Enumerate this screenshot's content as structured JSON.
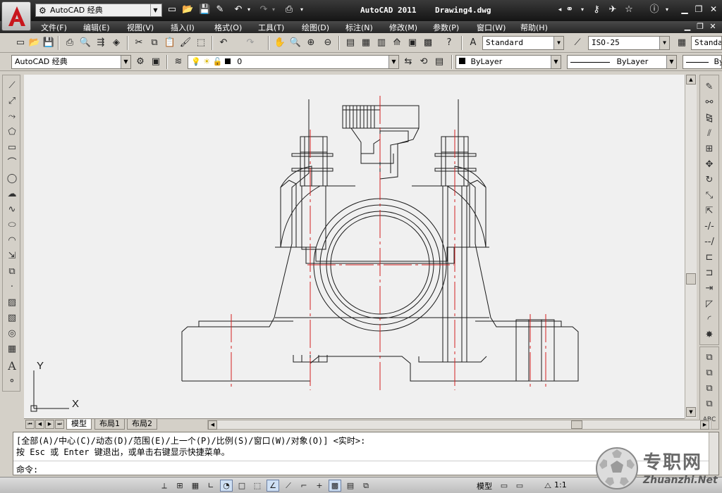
{
  "title_bar": {
    "workspace": "AutoCAD 经典",
    "app_name": "AutoCAD 2011",
    "document": "Drawing4.dwg",
    "quick_access_icons": [
      "new-icon",
      "open-icon",
      "save-icon",
      "save-as-icon",
      "undo-icon",
      "redo-icon",
      "plot-icon"
    ],
    "right_icons": [
      "binoculars-icon",
      "key-icon",
      "satellite-icon",
      "star-icon",
      "help-icon"
    ],
    "window_controls": [
      "minimize",
      "restore",
      "close"
    ]
  },
  "menu": {
    "items": [
      "文件(F)",
      "编辑(E)",
      "视图(V)",
      "插入(I)",
      "格式(O)",
      "工具(T)",
      "绘图(D)",
      "标注(N)",
      "修改(M)",
      "参数(P)",
      "窗口(W)",
      "帮助(H)"
    ]
  },
  "styles_toolbar": {
    "text_style": "Standard",
    "dim_style": "ISO-25",
    "table_style": "Standard"
  },
  "workspace_toolbar": {
    "workspace": "AutoCAD 经典"
  },
  "layers_toolbar": {
    "current_layer": "0"
  },
  "properties_toolbar": {
    "color": "ByLayer",
    "linetype": "ByLayer",
    "lineweight": "ByLayer"
  },
  "drawing": {
    "background": "#f0f0f0",
    "line_color": "#1a1a1a",
    "centerline_color": "#d42020",
    "ucs_x_label": "X",
    "ucs_y_label": "Y"
  },
  "tabs": {
    "items": [
      "模型",
      "布局1",
      "布局2"
    ],
    "active": "模型"
  },
  "command": {
    "history_1": "[全部(A)/中心(C)/动态(D)/范围(E)/上一个(P)/比例(S)/窗口(W)/对象(O)] <实时>:",
    "history_2": "按 Esc 或 Enter 键退出，或单击右键显示快捷菜单。",
    "prompt": "命令:",
    "input_value": ""
  },
  "status_bar": {
    "space_label": "模型",
    "scale": "1:1"
  },
  "watermark": {
    "chinese": "专职网",
    "url": "Zhuanzhi.Net"
  },
  "colors": {
    "title_bg": "#1e1e1e",
    "chrome": "#d4d0c8",
    "centerline": "#d42020"
  }
}
